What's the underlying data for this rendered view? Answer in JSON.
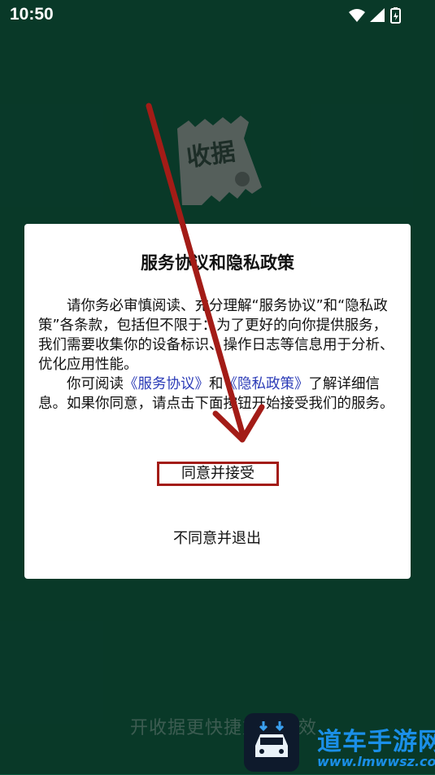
{
  "status_bar": {
    "time": "10:50",
    "icons": [
      "wifi-icon",
      "cellular-signal-icon",
      "battery-charging-icon"
    ]
  },
  "splash": {
    "logo_text": "收据",
    "slogan": "开收据更快捷方便高效"
  },
  "dialog": {
    "title": "服务协议和隐私政策",
    "paragraph1": "请你务必审慎阅读、充分理解“服务协议”和“隐私政策”各条款，包括但不限于：为了更好的向你提供服务，我们需要收集你的设备标识、操作日志等信息用于分析、优化应用性能。",
    "paragraph2_prefix": "你可阅读",
    "service_link": "《服务协议》",
    "paragraph2_and": "和",
    "privacy_link": "《隐私政策》",
    "paragraph2_suffix": "了解详细信息。如果你同意，请点击下面按钮开始接受我们的服务。",
    "agree_label": "同意并接受",
    "disagree_label": "不同意并退出"
  },
  "watermark": {
    "text": "道车手游网",
    "url": "www.lmwwsz.com"
  },
  "colors": {
    "background": "#0f5c42",
    "link": "#2b3bb7",
    "annotation_red": "#a31c17",
    "watermark_blue": "#1a8fe8"
  }
}
